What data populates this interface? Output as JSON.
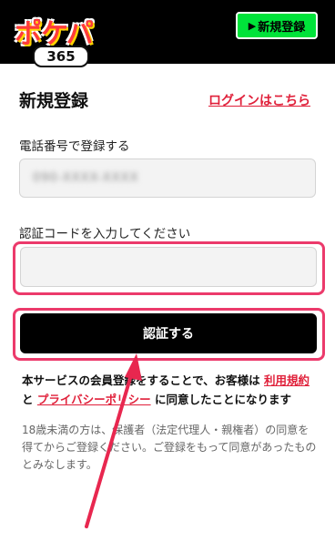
{
  "header": {
    "logo_text": "ポケパ",
    "logo_number": "365",
    "register_button": "新規登録",
    "register_arrow": "▶"
  },
  "main": {
    "title": "新規登録",
    "login_link": "ログインはこちら",
    "phone_label": "電話番号で登録する",
    "phone_value": "090-XXXX-XXXX",
    "code_label": "認証コードを入力してください",
    "code_value": "",
    "submit_button": "認証する"
  },
  "terms": {
    "text1": "本サービスの会員登録をすることで、お客様は ",
    "terms_link": "利用規約",
    "text2": "と ",
    "privacy_link": "プライバシーポリシー",
    "text3": " に同意したことになります"
  },
  "notice": "18歳未満の方は、保護者（法定代理人・親権者）の同意を得てからご登録ください。ご登録をもって同意があったものとみなします。",
  "colors": {
    "header_bg": "#000000",
    "accent_green": "#00e33a",
    "link_red": "#e0203a",
    "highlight_pink": "#ec3a6b"
  }
}
